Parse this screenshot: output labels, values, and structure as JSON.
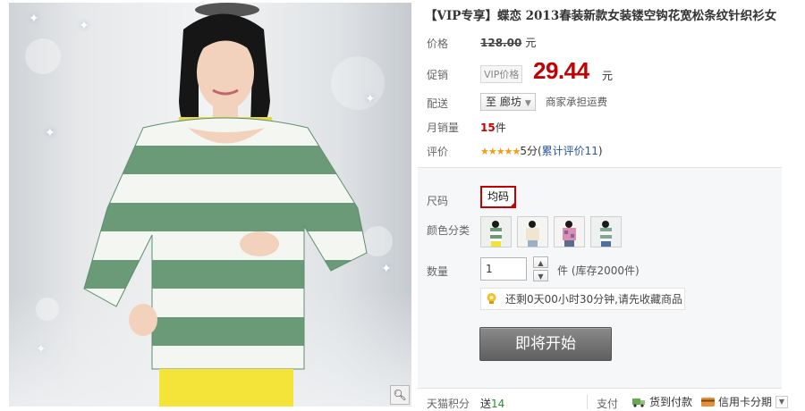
{
  "product": {
    "title": "【VIP专享】蝶恋 2013春装新款女装镂空钩花宽松条纹针织衫女"
  },
  "price": {
    "label": "价格",
    "original": "128.00",
    "unit": "元"
  },
  "promo": {
    "label": "促销",
    "tag": "VIP价格",
    "price": "29.44",
    "unit": "元"
  },
  "shipping": {
    "label": "配送",
    "destination": "至 廊坊",
    "note": "商家承担运费"
  },
  "sales": {
    "label": "月销量",
    "count": "15",
    "unit": "件"
  },
  "rating": {
    "label": "评价",
    "stars": "★★★★★",
    "score": "5分",
    "reviews_link": "累计评价11"
  },
  "options": {
    "size_label": "尺码",
    "size_value": "均码",
    "color_label": "颜色分类",
    "color_swatches": [
      "green-white-stripe",
      "beige-top",
      "pink-print",
      "grey-green-stripe"
    ]
  },
  "quantity": {
    "label": "数量",
    "value": "1",
    "stock": "件 (库存2000件)"
  },
  "tip": {
    "text": "还剩0天00小时30分钟,请先收藏商品"
  },
  "buy_button": {
    "label": "即将开始"
  },
  "bottom": {
    "points_label": "天猫积分",
    "points_prefix": "送",
    "points_value": "14",
    "pay_label": "支付",
    "cod": "货到付款",
    "installment": "信用卡分期"
  },
  "colors": {
    "accent_red": "#c40000",
    "stripe_green": "#6a9a78",
    "link_blue": "#2953a6",
    "star_orange": "#f39c12"
  }
}
